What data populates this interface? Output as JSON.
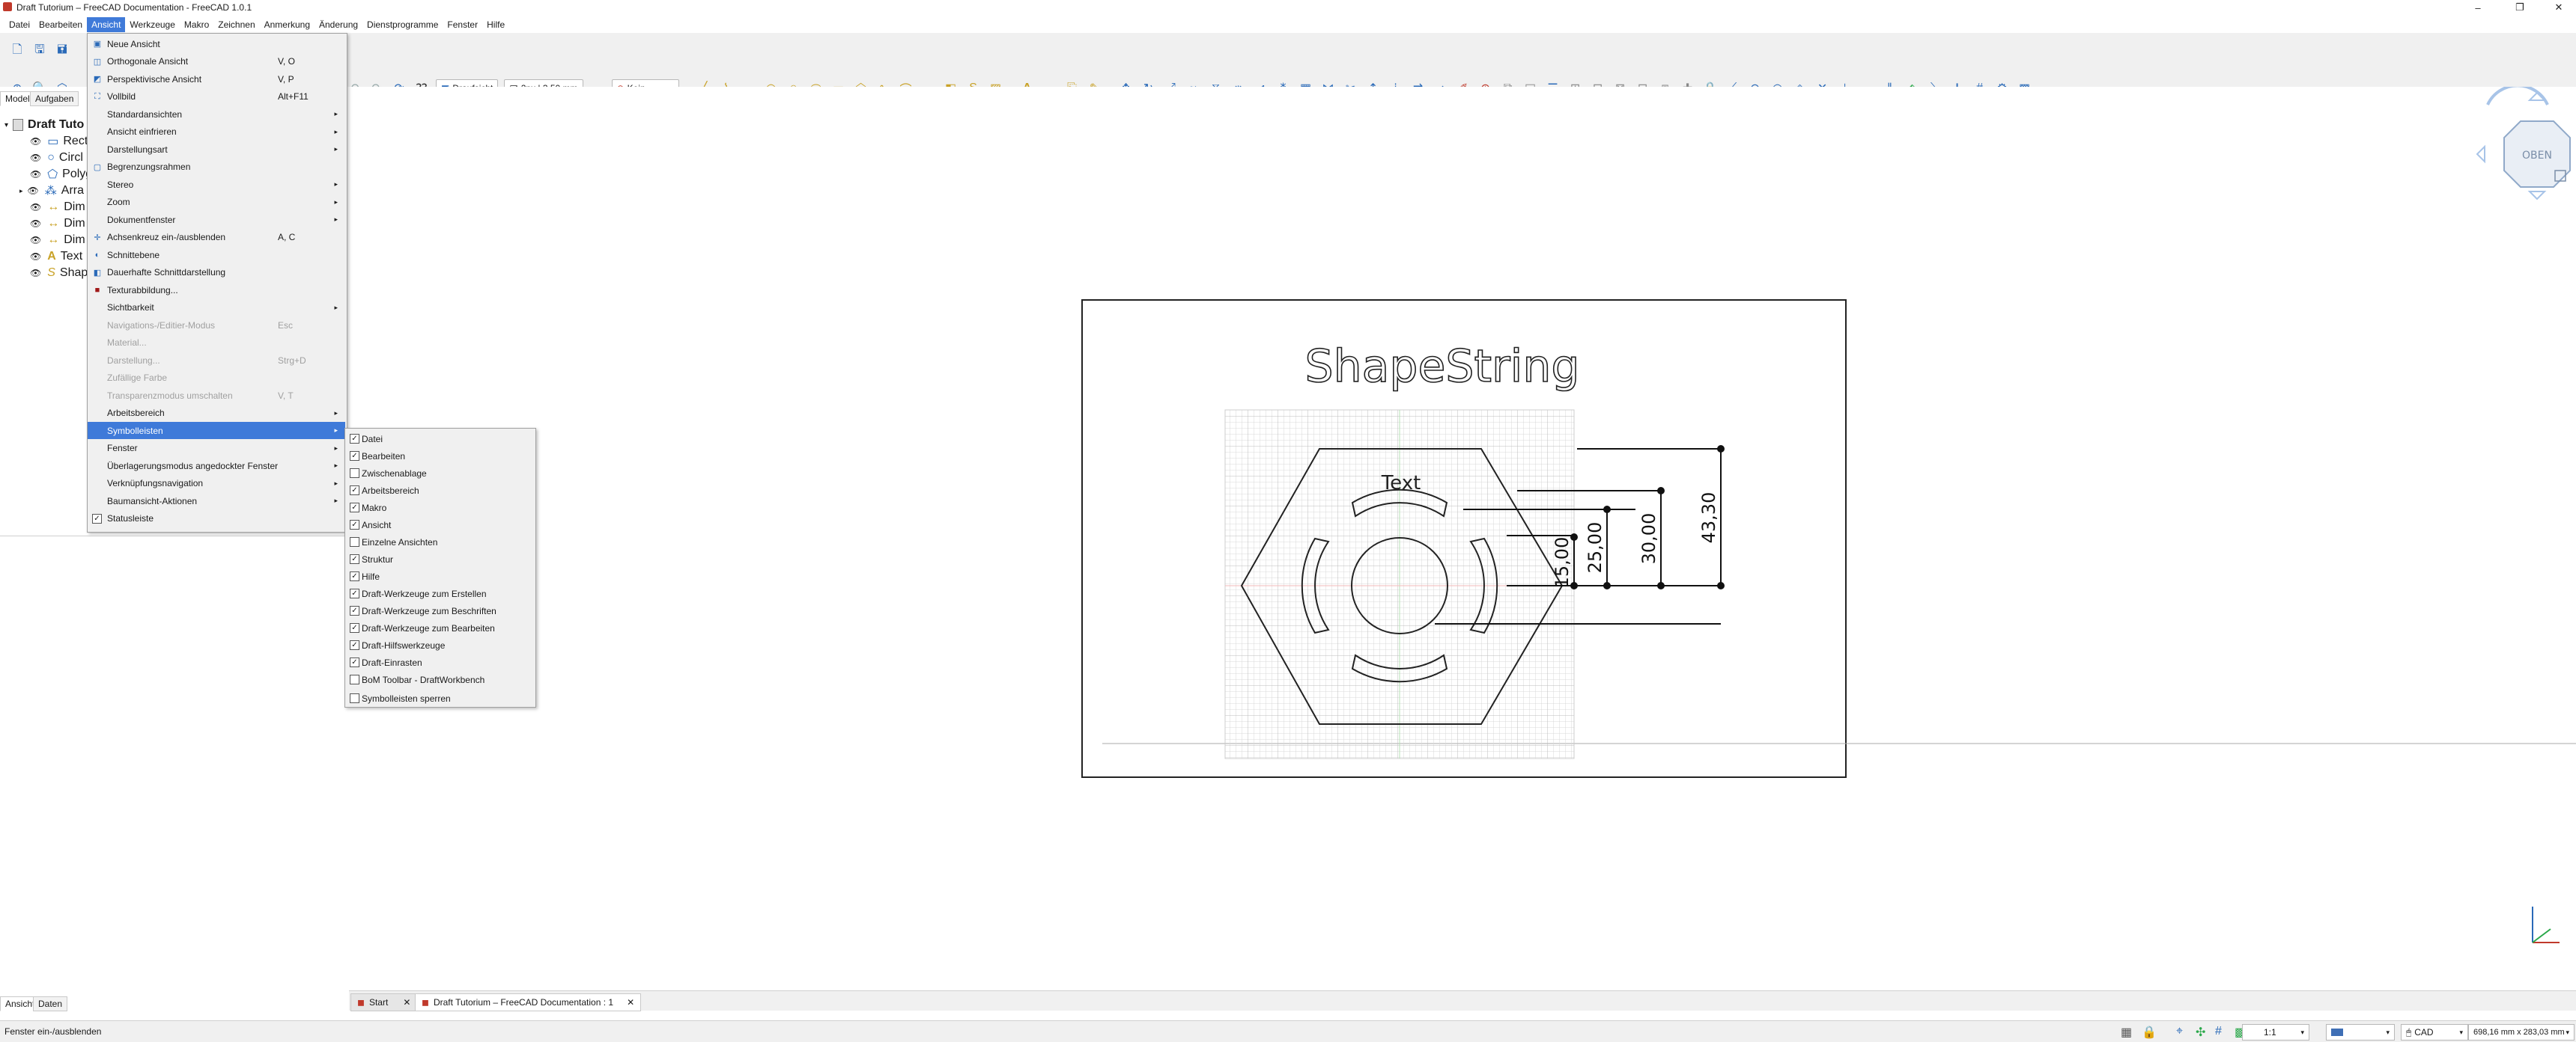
{
  "window": {
    "title": "Draft Tutorium – FreeCAD Documentation - FreeCAD 1.0.1",
    "minimize": "–",
    "restore": "❐",
    "close": "✕"
  },
  "menubar": [
    "Datei",
    "Bearbeiten",
    "Ansicht",
    "Werkzeuge",
    "Makro",
    "Zeichnen",
    "Anmerkung",
    "Änderung",
    "Dienstprogramme",
    "Fenster",
    "Hilfe"
  ],
  "toolbar": {
    "view_combo": "Draufsicht",
    "style_combo": "2px | 3,50 mm",
    "snap_combo": "Kein"
  },
  "panel": {
    "tabs": [
      "Modell",
      "Aufgaben"
    ],
    "bottom_tabs": [
      "Ansicht",
      "Daten"
    ],
    "tree_root": "Draft Tuto",
    "tree_items": [
      "Rect",
      "Circl",
      "Polyg",
      "Arra",
      "Dim",
      "Dim",
      "Dim",
      "Text",
      "Shap"
    ]
  },
  "view_menu": [
    {
      "label": "Neue Ansicht",
      "shortcut": "",
      "icon": "new-view-icon"
    },
    {
      "label": "Orthogonale Ansicht",
      "shortcut": "V, O",
      "icon": "ortho-view-icon"
    },
    {
      "label": "Perspektivische Ansicht",
      "shortcut": "V, P",
      "icon": "perspective-view-icon"
    },
    {
      "label": "Vollbild",
      "shortcut": "Alt+F11",
      "icon": "fullscreen-icon"
    },
    {
      "label": "Standardansichten",
      "submenu": true
    },
    {
      "label": "Ansicht einfrieren",
      "submenu": true
    },
    {
      "label": "Darstellungsart",
      "submenu": true
    },
    {
      "label": "Begrenzungsrahmen",
      "icon": "bounding-box-icon"
    },
    {
      "label": "Stereo",
      "submenu": true
    },
    {
      "label": "Zoom",
      "submenu": true
    },
    {
      "label": "Dokumentfenster",
      "submenu": true
    },
    {
      "label": "Achsenkreuz ein-/ausblenden",
      "shortcut": "A, C",
      "icon": "axis-cross-icon"
    },
    {
      "label": "Schnittebene",
      "icon": "clipping-plane-icon"
    },
    {
      "label": "Dauerhafte Schnittdarstellung",
      "icon": "persistent-section-icon"
    },
    {
      "label": "Texturabbildung...",
      "icon": "texture-icon"
    },
    {
      "label": "Sichtbarkeit",
      "submenu": true
    },
    {
      "label": "Navigations-/Editier-Modus",
      "shortcut": "Esc",
      "disabled": true
    },
    {
      "label": "Material...",
      "disabled": true
    },
    {
      "label": "Darstellung...",
      "shortcut": "Strg+D",
      "disabled": true
    },
    {
      "label": "Zufällige Farbe",
      "disabled": true
    },
    {
      "label": "Transparenzmodus umschalten",
      "shortcut": "V, T",
      "disabled": true
    },
    {
      "label": "Arbeitsbereich",
      "submenu": true
    },
    {
      "label": "Symbolleisten",
      "submenu": true,
      "highlight": true
    },
    {
      "label": "Fenster",
      "submenu": true
    },
    {
      "label": "Überlagerungsmodus angedockter Fenster",
      "submenu": true
    },
    {
      "label": "Verknüpfungsnavigation",
      "submenu": true
    },
    {
      "label": "Baumansicht-Aktionen",
      "submenu": true
    },
    {
      "label": "Statusleiste",
      "check": true,
      "checked": true
    }
  ],
  "toolbars_menu": [
    {
      "label": "Datei",
      "checked": true
    },
    {
      "label": "Bearbeiten",
      "checked": true
    },
    {
      "label": "Zwischenablage",
      "checked": false
    },
    {
      "label": "Arbeitsbereich",
      "checked": true
    },
    {
      "label": "Makro",
      "checked": true
    },
    {
      "label": "Ansicht",
      "checked": true
    },
    {
      "label": "Einzelne Ansichten",
      "checked": false
    },
    {
      "label": "Struktur",
      "checked": true
    },
    {
      "label": "Hilfe",
      "checked": true
    },
    {
      "label": "Draft-Werkzeuge zum Erstellen",
      "checked": true
    },
    {
      "label": "Draft-Werkzeuge zum Beschriften",
      "checked": true
    },
    {
      "label": "Draft-Werkzeuge zum Bearbeiten",
      "checked": true
    },
    {
      "label": "Draft-Hilfswerkzeuge",
      "checked": true
    },
    {
      "label": "Draft-Einrasten",
      "checked": true
    },
    {
      "label": "BoM Toolbar - DraftWorkbench",
      "checked": false
    },
    {
      "label": "Symbolleisten sperren",
      "checked": false
    }
  ],
  "drawing": {
    "title": "ShapeString",
    "text_label": "Text",
    "dims": [
      "15,00",
      "25,00",
      "30,00",
      "43,30"
    ]
  },
  "navcube": {
    "face": "OBEN"
  },
  "doctabs": [
    {
      "label": "Start"
    },
    {
      "label": "Draft Tutorium – FreeCAD Documentation : 1"
    }
  ],
  "status": {
    "message": "Fenster ein-/ausblenden",
    "scale": "1:1",
    "nav_style": "CAD",
    "dimensions": "698,16 mm x 283,03 mm"
  }
}
